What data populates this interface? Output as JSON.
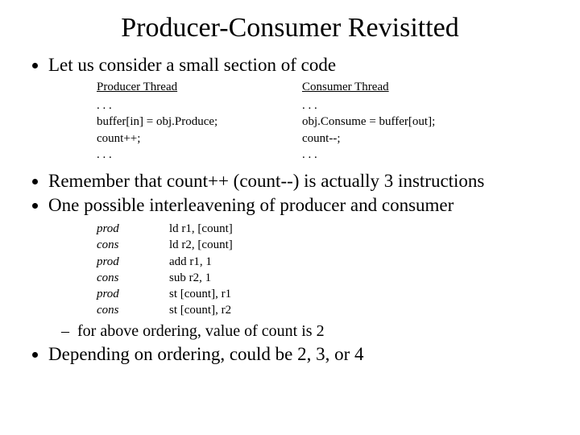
{
  "title": "Producer-Consumer Revisitted",
  "bullets": {
    "b1": "Let us consider a small section of code",
    "b2": "Remember that count++ (count--) is actually 3 instructions",
    "b3": "One possible interleavening of producer and consumer",
    "b3_sub": "for above ordering, value of count is 2",
    "b4": "Depending on ordering, could be 2, 3, or 4"
  },
  "threads": {
    "producer": {
      "header": "Producer Thread",
      "lines": [
        ". . .",
        "buffer[in] = obj.Produce;",
        "count++;",
        ". . ."
      ]
    },
    "consumer": {
      "header": "Consumer Thread",
      "lines": [
        ". . .",
        "obj.Consume = buffer[out];",
        "count--;",
        ". . ."
      ]
    }
  },
  "interleave": [
    {
      "role": "prod",
      "instr": "ld r1, [count]"
    },
    {
      "role": "cons",
      "instr": "ld r2, [count]"
    },
    {
      "role": "prod",
      "instr": "add r1, 1"
    },
    {
      "role": "cons",
      "instr": "sub r2, 1"
    },
    {
      "role": "prod",
      "instr": "st [count], r1"
    },
    {
      "role": "cons",
      "instr": "st [count], r2"
    }
  ]
}
